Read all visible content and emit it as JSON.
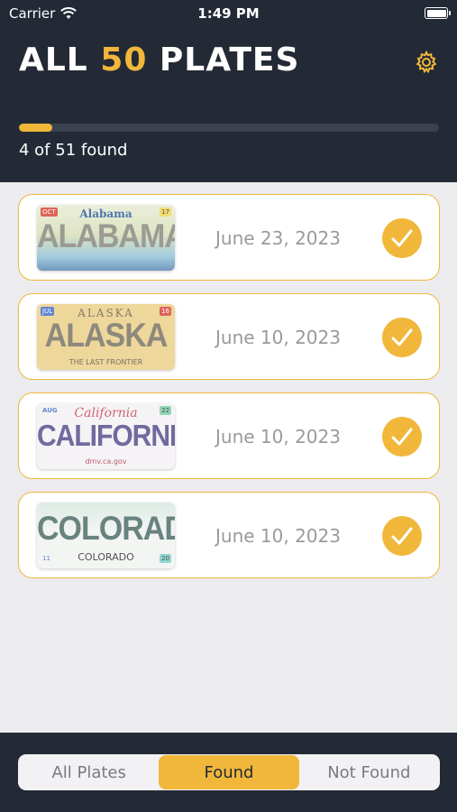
{
  "status_bar": {
    "carrier": "Carrier",
    "time": "1:49 PM"
  },
  "header": {
    "title_prefix": "ALL ",
    "title_number": "50",
    "title_suffix": " PLATES",
    "progress_text": "4 of 51 found",
    "progress_found": 4,
    "progress_total": 51,
    "settings_icon": "gear-icon"
  },
  "colors": {
    "accent": "#f0b73a",
    "header_bg": "#232a35",
    "list_bg": "#ececee",
    "date_text": "#9a9a9e"
  },
  "plates": [
    {
      "state": "Alabama",
      "date": "June 23, 2023",
      "plate_top": "Alabama",
      "plate_main": "ALABAMA",
      "plate_bottom": "",
      "tag_left": "OCT",
      "tag_right": "17"
    },
    {
      "state": "Alaska",
      "date": "June 10, 2023",
      "plate_top": "ALASKA",
      "plate_main": "ALASKA",
      "plate_bottom": "THE LAST FRONTIER",
      "tag_left": "JUL",
      "tag_right": "16"
    },
    {
      "state": "California",
      "date": "June 10, 2023",
      "plate_top": "California",
      "plate_main": "CALIFORNIA",
      "plate_bottom": "dmv.ca.gov",
      "tag_left": "AUG",
      "tag_right": "22"
    },
    {
      "state": "Colorado",
      "date": "June 10, 2023",
      "plate_top": "",
      "plate_main": "COLORADO",
      "plate_bottom": "COLORADO",
      "tag_left": "11",
      "tag_right": "20"
    }
  ],
  "filter": {
    "segments": [
      "All Plates",
      "Found",
      "Not Found"
    ],
    "selected": "Found"
  }
}
